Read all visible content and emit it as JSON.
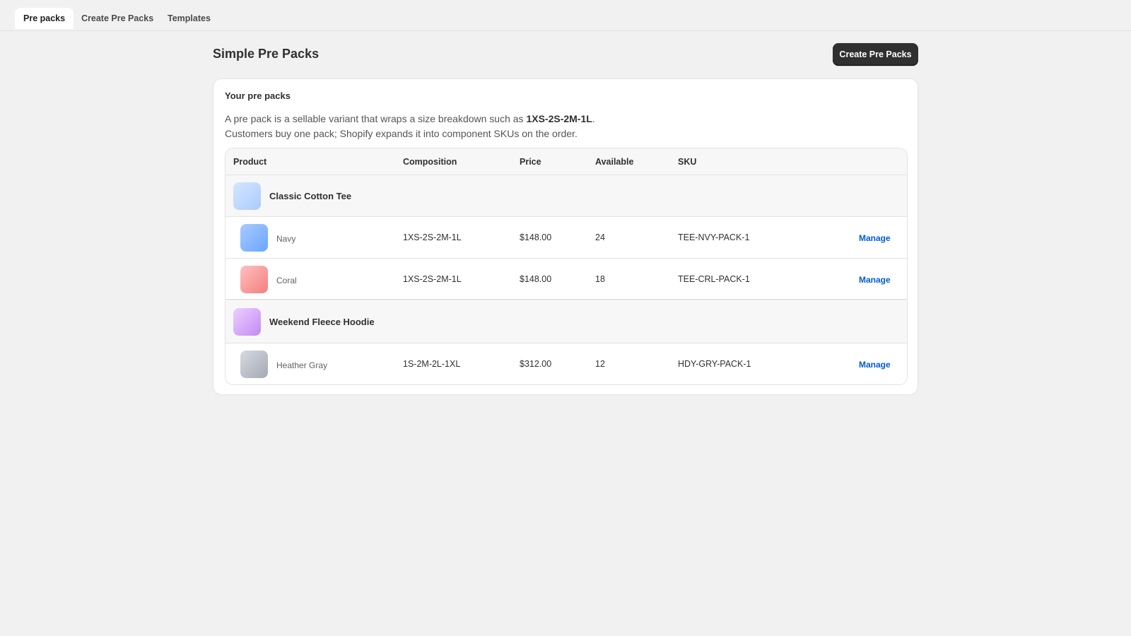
{
  "tabs": [
    {
      "label": "Pre packs",
      "active": true
    },
    {
      "label": "Create Pre Packs",
      "active": false
    },
    {
      "label": "Templates",
      "active": false
    }
  ],
  "header": {
    "title": "Simple Pre Packs",
    "create_button": "Create Pre Packs"
  },
  "card": {
    "title": "Your pre packs",
    "description_line1_prefix": "A pre pack is a sellable variant that wraps a size breakdown such as ",
    "description_line1_bold": "1XS-2S-2M-1L",
    "description_line1_suffix": ".",
    "description_line2": "Customers buy one pack; Shopify expands it into component SKUs on the order."
  },
  "table": {
    "columns": [
      "Product",
      "Composition",
      "Price",
      "Available",
      "SKU"
    ],
    "manage_label": "Manage",
    "groups": [
      {
        "name": "Classic Cotton Tee",
        "thumb_colors": [
          "#d6e6ff",
          "#aacbff"
        ],
        "variants": [
          {
            "name": "Navy",
            "composition": "1XS-2S-2M-1L",
            "price": "$148.00",
            "available": "24",
            "sku": "TEE-NVY-PACK-1",
            "thumb_colors": [
              "#a9cbff",
              "#6aa5ff"
            ]
          },
          {
            "name": "Coral",
            "composition": "1XS-2S-2M-1L",
            "price": "$148.00",
            "available": "18",
            "sku": "TEE-CRL-PACK-1",
            "thumb_colors": [
              "#ffc0c0",
              "#f47e7e"
            ]
          }
        ]
      },
      {
        "name": "Weekend Fleece Hoodie",
        "thumb_colors": [
          "#ecd0ff",
          "#c48af4"
        ],
        "variants": [
          {
            "name": "Heather Gray",
            "composition": "1S-2M-2L-1XL",
            "price": "$312.00",
            "available": "12",
            "sku": "HDY-GRY-PACK-1",
            "thumb_colors": [
              "#d7dae0",
              "#a4a9b3"
            ]
          }
        ]
      }
    ]
  },
  "colors": {
    "background": "#f1f1f1",
    "primary_button": "#303030",
    "link": "#005bd3"
  }
}
